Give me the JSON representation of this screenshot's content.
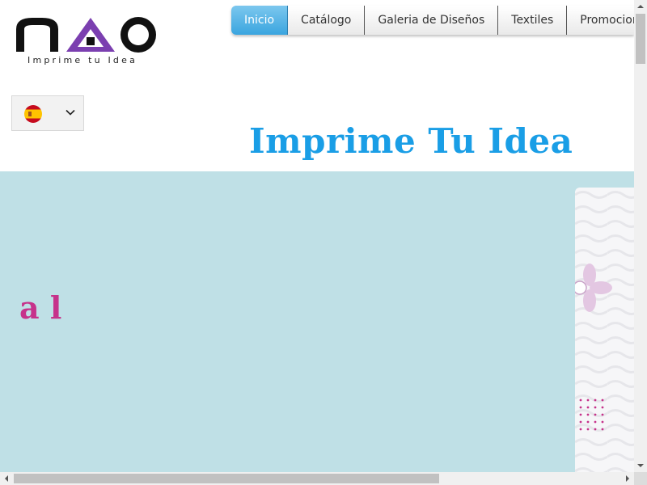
{
  "logo": {
    "brand_alt": "nao",
    "tagline": "Imprime tu Idea",
    "brand_colors": {
      "dark": "#111111",
      "accent": "#7b3fb0"
    }
  },
  "nav": {
    "items": [
      {
        "label": "Inicio",
        "active": true
      },
      {
        "label": "Catálogo",
        "active": false
      },
      {
        "label": "Galeria de Diseños",
        "active": false
      },
      {
        "label": "Textiles",
        "active": false
      },
      {
        "label": "Promociona",
        "active": false
      }
    ]
  },
  "language": {
    "flag_icon": "spain-flag-icon",
    "dropdown_icon": "chevron-down-icon"
  },
  "hero": {
    "title": "Imprime Tu Idea",
    "title_color": "#1a9ee6",
    "band_color": "#bfe0e6"
  },
  "promo": {
    "text": "a l",
    "text_color": "#c6338b"
  }
}
